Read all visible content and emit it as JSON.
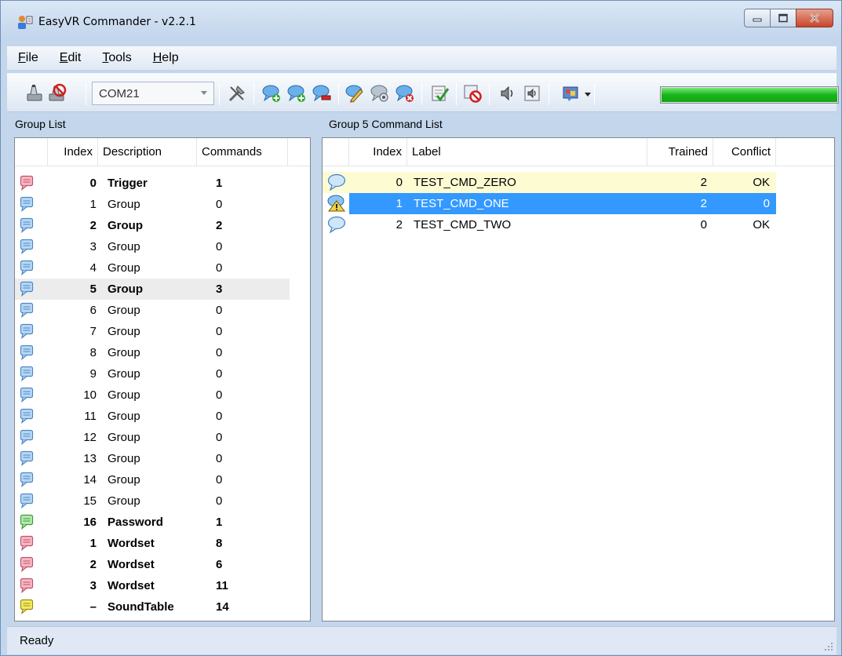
{
  "window": {
    "title": "EasyVR Commander - v2.2.1"
  },
  "menu": [
    {
      "key": "F",
      "rest": "ile"
    },
    {
      "key": "E",
      "rest": "dit"
    },
    {
      "key": "T",
      "rest": "ools"
    },
    {
      "key": "H",
      "rest": "elp"
    }
  ],
  "toolbar": {
    "port": "COM21",
    "level_percent": 100,
    "icons": [
      "connect-icon",
      "disconnect-icon",
      "settings-icon",
      "add-command-icon",
      "insert-command-icon",
      "remove-command-icon",
      "edit-command-icon",
      "train-command-icon",
      "erase-training-icon",
      "test-group-icon",
      "stop-icon",
      "speak-icon",
      "sound-table-icon",
      "language-icon"
    ]
  },
  "group_panel": {
    "title": "Group List",
    "columns": [
      "Index",
      "Description",
      "Commands"
    ],
    "rows": [
      {
        "index": "0",
        "description": "Trigger",
        "commands": "1",
        "bold": true,
        "icon": "pink"
      },
      {
        "index": "1",
        "description": "Group",
        "commands": "0",
        "bold": false,
        "icon": "blue"
      },
      {
        "index": "2",
        "description": "Group",
        "commands": "2",
        "bold": true,
        "icon": "blue"
      },
      {
        "index": "3",
        "description": "Group",
        "commands": "0",
        "bold": false,
        "icon": "blue"
      },
      {
        "index": "4",
        "description": "Group",
        "commands": "0",
        "bold": false,
        "icon": "blue"
      },
      {
        "index": "5",
        "description": "Group",
        "commands": "3",
        "bold": true,
        "icon": "blue",
        "selected": true
      },
      {
        "index": "6",
        "description": "Group",
        "commands": "0",
        "bold": false,
        "icon": "blue"
      },
      {
        "index": "7",
        "description": "Group",
        "commands": "0",
        "bold": false,
        "icon": "blue"
      },
      {
        "index": "8",
        "description": "Group",
        "commands": "0",
        "bold": false,
        "icon": "blue"
      },
      {
        "index": "9",
        "description": "Group",
        "commands": "0",
        "bold": false,
        "icon": "blue"
      },
      {
        "index": "10",
        "description": "Group",
        "commands": "0",
        "bold": false,
        "icon": "blue"
      },
      {
        "index": "11",
        "description": "Group",
        "commands": "0",
        "bold": false,
        "icon": "blue"
      },
      {
        "index": "12",
        "description": "Group",
        "commands": "0",
        "bold": false,
        "icon": "blue"
      },
      {
        "index": "13",
        "description": "Group",
        "commands": "0",
        "bold": false,
        "icon": "blue"
      },
      {
        "index": "14",
        "description": "Group",
        "commands": "0",
        "bold": false,
        "icon": "blue"
      },
      {
        "index": "15",
        "description": "Group",
        "commands": "0",
        "bold": false,
        "icon": "blue"
      },
      {
        "index": "16",
        "description": "Password",
        "commands": "1",
        "bold": true,
        "icon": "green"
      },
      {
        "index": "1",
        "description": "Wordset",
        "commands": "8",
        "bold": true,
        "icon": "pink"
      },
      {
        "index": "2",
        "description": "Wordset",
        "commands": "6",
        "bold": true,
        "icon": "pink"
      },
      {
        "index": "3",
        "description": "Wordset",
        "commands": "11",
        "bold": true,
        "icon": "pink"
      },
      {
        "index": "–",
        "description": "SoundTable",
        "commands": "14",
        "bold": true,
        "icon": "yellow"
      }
    ]
  },
  "command_panel": {
    "title": "Group 5 Command List",
    "columns": [
      "Index",
      "Label",
      "Trained",
      "Conflict"
    ],
    "rows": [
      {
        "index": "0",
        "label": "TEST_CMD_ZERO",
        "trained": "2",
        "conflict": "OK",
        "state": "yellow",
        "icon": "bubble"
      },
      {
        "index": "1",
        "label": "TEST_CMD_ONE",
        "trained": "2",
        "conflict": "0",
        "state": "blue",
        "icon": "warning"
      },
      {
        "index": "2",
        "label": "TEST_CMD_TWO",
        "trained": "0",
        "conflict": "OK",
        "state": "none",
        "icon": "bubble"
      }
    ]
  },
  "status": {
    "text": "Ready"
  },
  "colors": {
    "selection": "#3399ff",
    "highlight_yellow": "#fdfbd2",
    "level_green": "#19b419",
    "frame": "#c3d6ec"
  }
}
